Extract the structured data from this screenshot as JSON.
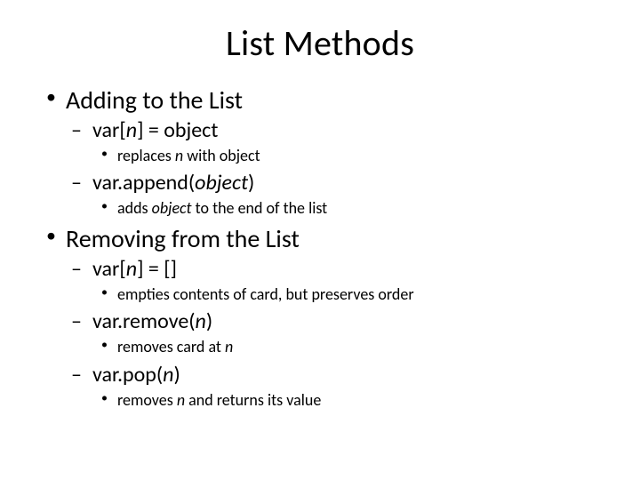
{
  "title": "List Methods",
  "sections": [
    {
      "heading": "Adding to the List",
      "items": [
        {
          "code_pre": "var[",
          "code_ital": "n",
          "code_post": "] = object",
          "desc_pre": "replaces ",
          "desc_ital": "n",
          "desc_post": " with object"
        },
        {
          "code_pre": "var.append(",
          "code_ital": "object",
          "code_post": ")",
          "desc_pre": "adds ",
          "desc_ital": "object",
          "desc_post": " to the end of the list"
        }
      ]
    },
    {
      "heading": "Removing from the List",
      "items": [
        {
          "code_pre": "var[",
          "code_ital": "n",
          "code_post": "] = []",
          "desc_pre": "empties contents of card, but preserves order",
          "desc_ital": "",
          "desc_post": ""
        },
        {
          "code_pre": "var.remove(",
          "code_ital": "n",
          "code_post": ")",
          "desc_pre": "removes card at ",
          "desc_ital": "n",
          "desc_post": ""
        },
        {
          "code_pre": "var.pop(",
          "code_ital": "n",
          "code_post": ")",
          "desc_pre": "removes ",
          "desc_ital": "n",
          "desc_post": " and returns its value"
        }
      ]
    }
  ]
}
